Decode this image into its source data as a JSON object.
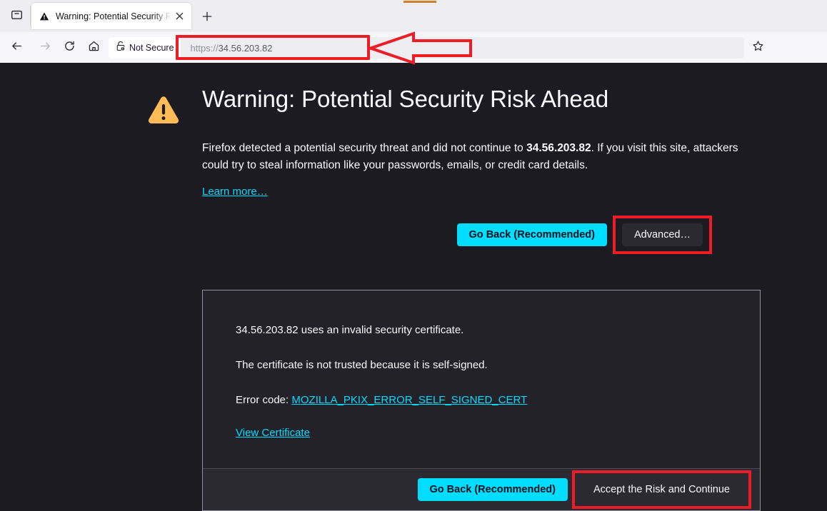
{
  "browser": {
    "tab": {
      "title": "Warning: Potential Security Risk Ahead",
      "favicon_icon": "warning-triangle-icon",
      "close_icon": "close-icon"
    },
    "tab_list_icon": "tab-list-icon",
    "new_tab_icon": "plus-icon",
    "toolbar": {
      "back_icon": "back-arrow-icon",
      "forward_icon": "forward-arrow-icon",
      "reload_icon": "reload-icon",
      "home_icon": "home-icon",
      "bookmark_icon": "star-icon"
    },
    "urlbar": {
      "identity_icon": "lock-warning-icon",
      "identity_label": "Not Secure",
      "url_scheme": "https://",
      "url_host": "34.56.203.82",
      "url_full": "https://34.56.203.82"
    }
  },
  "page": {
    "warning_icon": "warning-triangle-icon",
    "title": "Warning: Potential Security Risk Ahead",
    "body_prefix": "Firefox detected a potential security threat and did not continue to ",
    "body_host": "34.56.203.82",
    "body_suffix": ". If you visit this site, attackers could try to steal information like your passwords, emails, or credit card details.",
    "learn_more": "Learn more…",
    "go_back_label": "Go Back (Recommended)",
    "advanced_label": "Advanced…",
    "advanced_panel": {
      "line1": "34.56.203.82 uses an invalid security certificate.",
      "line2": "The certificate is not trusted because it is self-signed.",
      "error_code_label": "Error code: ",
      "error_code_link": "MOZILLA_PKIX_ERROR_SELF_SIGNED_CERT",
      "view_certificate": "View Certificate",
      "footer_go_back_label": "Go Back (Recommended)",
      "footer_accept_label": "Accept the Risk and Continue"
    }
  },
  "annotations": {
    "url_callout_arrow": "left-pointing-arrow",
    "highlight_color": "#ee1c25"
  },
  "colors": {
    "accent_cyan": "#00ddff",
    "warning_amber": "#ffbb55",
    "page_background": "#1c1b22",
    "panel_background": "#23222b",
    "highlight_red": "#ee1c25"
  }
}
